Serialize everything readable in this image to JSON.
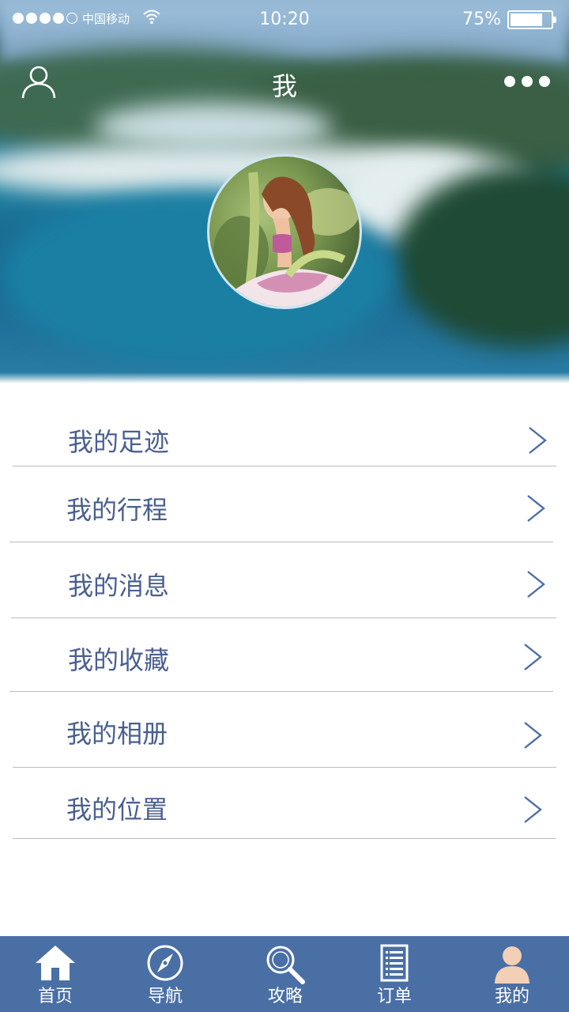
{
  "status_bar": {
    "carrier": "中国移动",
    "time": "10:20",
    "battery": "75%",
    "battery_level": 0.75,
    "signal_strength": 4
  },
  "header": {
    "title": "我",
    "left_icon": "user-icon",
    "right_icon": "more-icon"
  },
  "menu": {
    "items": [
      {
        "label": "我的足迹"
      },
      {
        "label": "我的行程"
      },
      {
        "label": "我的消息"
      },
      {
        "label": "我的收藏"
      },
      {
        "label": "我的相册"
      },
      {
        "label": "我的位置"
      }
    ]
  },
  "tabbar": {
    "tabs": [
      {
        "label": "首页",
        "icon": "home-icon"
      },
      {
        "label": "导航",
        "icon": "compass-icon"
      },
      {
        "label": "攻略",
        "icon": "search-icon"
      },
      {
        "label": "订单",
        "icon": "order-list-icon"
      },
      {
        "label": "我的",
        "icon": "profile-icon",
        "active": true
      }
    ]
  },
  "colors": {
    "accent": "#4a6fa5",
    "menu_text": "#4a5f8f"
  }
}
